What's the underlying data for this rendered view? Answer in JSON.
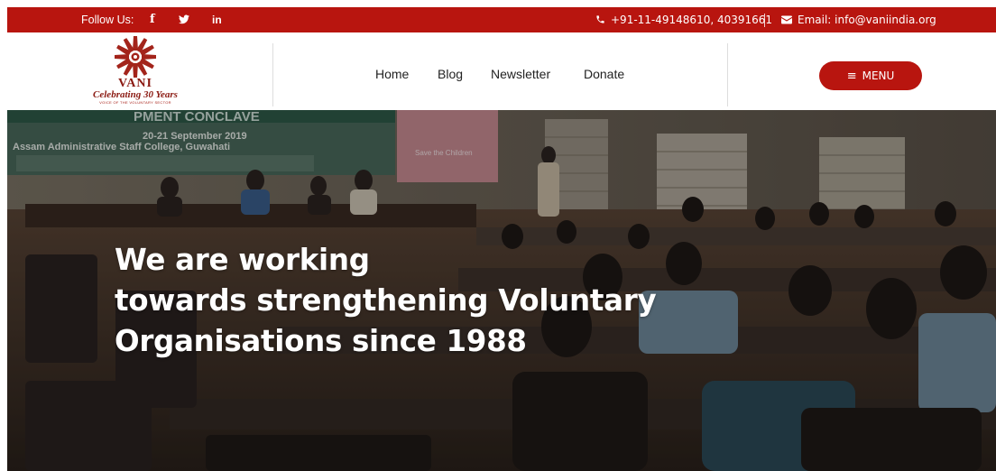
{
  "topbar": {
    "follow_label": "Follow Us:",
    "social": {
      "facebook": "f",
      "twitter": "twitter-icon",
      "linkedin": "in"
    },
    "phone": "+91-11-49148610, 40391661",
    "email": "Email: info@vaniindia.org",
    "color": "#b8150f"
  },
  "logo": {
    "name": "VANI",
    "tagline": "Celebrating 30 Years",
    "subtitle": "VOICE OF THE VOLUNTARY SECTOR"
  },
  "nav": {
    "items": [
      {
        "label": "Home"
      },
      {
        "label": "Blog"
      },
      {
        "label": "Newsletter"
      },
      {
        "label": "Donate"
      }
    ],
    "menu_label": "MENU"
  },
  "hero": {
    "heading_lines": [
      "We are working",
      "towards strengthening Voluntary",
      "Organisations since 1988"
    ],
    "banner_lines": [
      "PMENT CONCLAVE",
      "20-21 September 2019",
      "Assam Administrative Staff College, Guwahati"
    ],
    "sign_text": "Save the Children"
  }
}
